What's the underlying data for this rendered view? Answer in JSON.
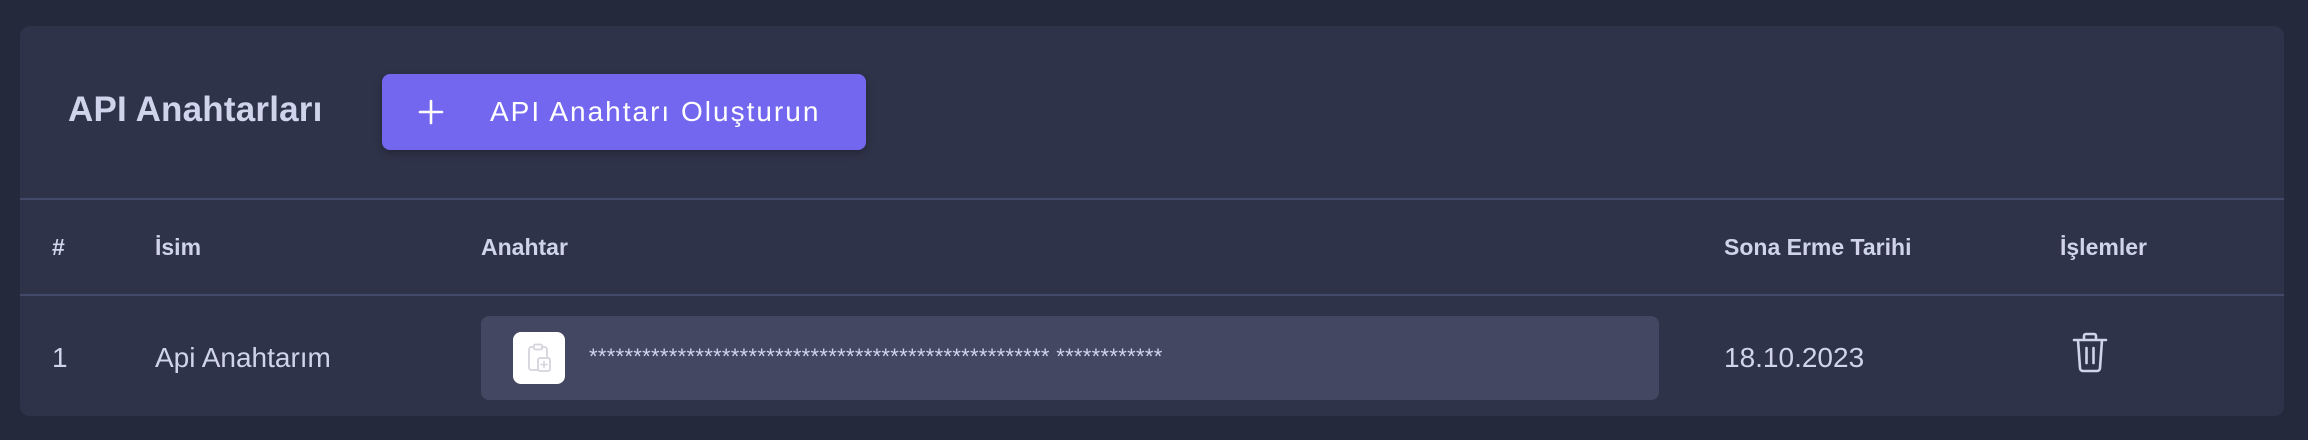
{
  "header": {
    "title": "API Anahtarları",
    "create_button_label": "API Anahtarı Oluşturun",
    "create_button_icon": "plus-icon"
  },
  "table": {
    "columns": [
      "#",
      "İsim",
      "Anahtar",
      "Sona Erme Tarihi",
      "İşlemler"
    ],
    "rows": [
      {
        "index": "1",
        "name": "Api Anahtarım",
        "key": "**************************************************** ************",
        "expiry": "18.10.2023",
        "copy_icon": "clipboard-copy-icon",
        "action_icon": "trash-icon"
      }
    ]
  },
  "colors": {
    "page_background": "#25293c",
    "card_background": "#2f3349",
    "accent": "#7367f0",
    "key_box": "#444761",
    "text": "#cfd3ec",
    "divider": "#434968"
  }
}
